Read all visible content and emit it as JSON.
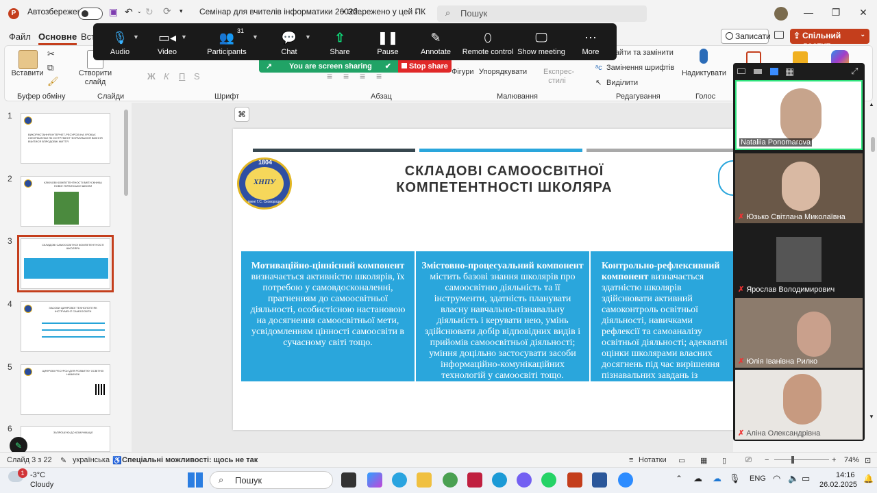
{
  "titlebar": {
    "autosave_label": "Автозбереження",
    "file_title": "Семінар для вчителів інформатики 26022...",
    "save_status": "• Збережено у цей ПК",
    "search_placeholder": "Пошук"
  },
  "ribbon_tabs": [
    "Файл",
    "Основне",
    "Вст"
  ],
  "record_label": "Записати",
  "share_label": "Спільний доступ",
  "ribbon": {
    "paste": "Вставити",
    "clipboard_group": "Буфер обміну",
    "new_slide": "Створити слайд",
    "slides_group": "Слайди",
    "font_group": "Шрифт",
    "paragraph_group": "Абзац",
    "shapes": "Фігури",
    "arrange": "Упорядкувати",
    "quick_styles": "Експрес-стилі",
    "drawing_group": "Малювання",
    "replace": "Знайти та замінити",
    "replace_fonts": "Замінення шрифтів",
    "select": "Виділити",
    "editing_group": "Редагування",
    "dictate": "Надиктувати",
    "voice_group": "Голос"
  },
  "zoom_toolbar": {
    "items": [
      {
        "label": "Audio",
        "icon": "microphone-icon"
      },
      {
        "label": "Video",
        "icon": "camera-icon"
      },
      {
        "label": "Participants",
        "icon": "participants-icon",
        "badge": "31"
      },
      {
        "label": "Chat",
        "icon": "chat-icon"
      },
      {
        "label": "Share",
        "icon": "share-icon"
      },
      {
        "label": "Pause",
        "icon": "pause-icon"
      },
      {
        "label": "Annotate",
        "icon": "pen-icon"
      },
      {
        "label": "Remote control",
        "icon": "mouse-icon"
      },
      {
        "label": "Show meeting",
        "icon": "monitor-icon"
      },
      {
        "label": "More",
        "icon": "more-icon"
      }
    ],
    "sharing_text": "You are screen sharing",
    "stop_share": "Stop share"
  },
  "thumbnails": [
    {
      "num": "1",
      "title": "ВИКОРИСТАННЯ ІНТЕРНЕТ-РЕСУРСІВ НА УРОКАХ ІНФОРМАТИКИ ЯК ІНСТРУМЕНТ ФОРМУВАННЯ ВМІННЯ ВЧИТИСЯ ВПРОДОВЖ ЖИТТЯ"
    },
    {
      "num": "2",
      "title": "КЛЮЧОВІ КОМПЕТЕНТНОСТІ ВИПУСКНИКА НОВОЇ УКРАЇНСЬКОЇ ШКОЛИ"
    },
    {
      "num": "3",
      "title": "СКЛАДОВІ САМООСВІТНОЇ КОМПЕТЕНТНОСТІ ШКОЛЯРА"
    },
    {
      "num": "4",
      "title": "ЗАСОБИ ЦИФРОВОЇ ТЕХНОЛОГІЇ ЯК ІНСТРУМЕНТ САМООСВІТИ"
    },
    {
      "num": "5",
      "title": "ЦИФРОВІ РЕСУРСИ ДЛЯ РОЗВИТКУ ОСВІТНІХ НАВИЧОК"
    },
    {
      "num": "6",
      "title": "ЗАПРОШУЮ ДО КОМУНІКАЦІЇ"
    }
  ],
  "slide": {
    "title_line1": "СКЛАДОВІ САМООСВІТНОЇ",
    "title_line2": "КОМПЕТЕНТНОСТІ ШКОЛЯРА",
    "logo_year": "1804",
    "logo_text": "ХНПУ",
    "logo_sub": "імені Г.С. Сковороди",
    "col1_bold": "Мотиваційно-ціннісний компонент",
    "col1_text": " визначається активністю школярів, їх потребою у самовдосконаленні, прагненням до самоосвітньої діяльності, особистісною настановою на досягнення самоосвітньої мети, усвідомленням цінності самоосвіти в сучасному світі тощо.",
    "col2_bold": "Змістовно-процесуальний компонент",
    "col2_text": " містить базові знання школярів про самоосвітню діяльність та її інструменти, здатність планувати власну навчально-пізнавальну діяльність і керувати нею, умінь здійснювати добір відповідних видів і прийомів самоосвітньої діяльності; уміння доцільно застосувати засоби інформаційно-комунікаційних технологій у самоосвіті тощо.",
    "col3_bold": "Контрольно-рефлексивний компонент",
    "col3_text": " визначається здатністю школярів здійснювати активний самоконтроль освітньої діяльності, навичками рефлексії та самоаналізу освітньої діяльності; адекватні оцінки школярами власних досягнень під час вирішення пізнавальних завдань із використанням сучасних інструментів."
  },
  "participants": [
    {
      "name": "Nataliia Ponomarova",
      "muted": false
    },
    {
      "name": "Юзько Світлана Миколаївна",
      "muted": true
    },
    {
      "name": "Ярослав Володимирович",
      "muted": true
    },
    {
      "name": "Юлія Іванівна Рилко",
      "muted": true
    },
    {
      "name": "Аліна Олександрівна",
      "muted": true
    }
  ],
  "statusbar": {
    "slide": "Слайд 3 з 22",
    "language": "українська",
    "accessibility": "Спеціальні можливості: щось не так",
    "notes": "Нотатки",
    "zoom": "74%"
  },
  "taskbar": {
    "weather_temp": "-3°C",
    "weather_desc": "Cloudy",
    "search": "Пошук",
    "lang": "ENG",
    "time": "14:16",
    "date": "26.02.2025",
    "notification_badge": "1"
  }
}
